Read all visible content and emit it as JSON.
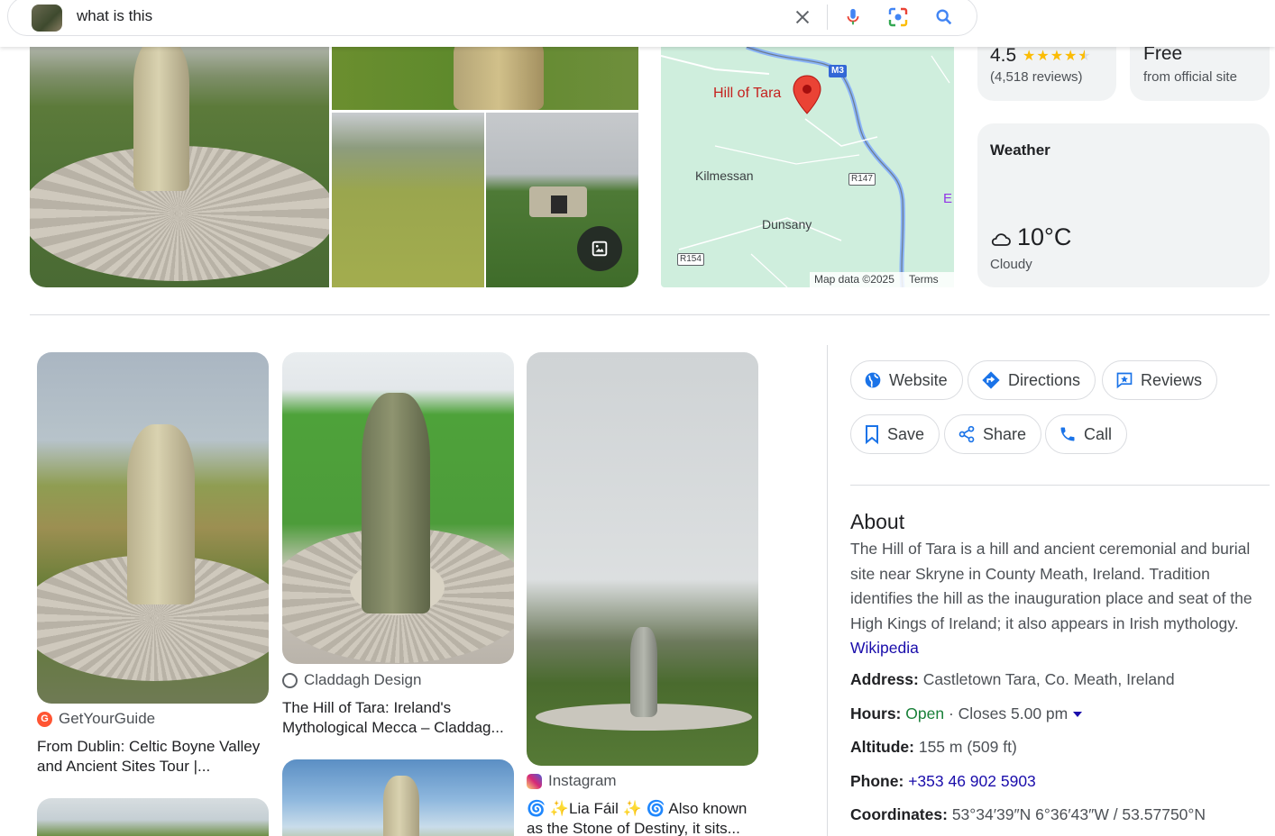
{
  "search": {
    "query": "what is this"
  },
  "map": {
    "place_label": "Hill of Tara",
    "towns": [
      "Kilmessan",
      "Dunsany"
    ],
    "roads": [
      "M3",
      "R147",
      "R154"
    ],
    "edge_letter": "E",
    "attribution": "Map data ©2025",
    "terms": "Terms"
  },
  "rating_card": {
    "rating": "4.5",
    "stars": 4.5,
    "reviews": "(4,518 reviews)"
  },
  "price_card": {
    "price": "Free",
    "note": "from official site"
  },
  "weather": {
    "title": "Weather",
    "temperature": "10°C",
    "condition": "Cloudy",
    "icon": "cloud-icon"
  },
  "visual_matches": [
    {
      "source": "GetYourGuide",
      "title_line1": "From Dublin: Celtic Boyne Valley",
      "title_line2": "and Ancient Sites Tour |...",
      "source_color": "#ff5533"
    },
    {
      "source": "Claddagh Design",
      "title_line1": "The Hill of Tara: Ireland's",
      "title_line2": "Mythological Mecca – Claddag...",
      "source_color": "#5f6368"
    },
    {
      "source": "Instagram",
      "title_line1": "🌀 ✨Lia Fáil ✨ 🌀 Also known",
      "title_line2": "as the Stone of Destiny, it sits...",
      "source_color": "#e1306c"
    }
  ],
  "actions": {
    "website": "Website",
    "directions": "Directions",
    "reviews": "Reviews",
    "save": "Save",
    "share": "Share",
    "call": "Call"
  },
  "about": {
    "heading": "About",
    "text": "The Hill of Tara is a hill and ancient ceremonial and burial site near Skryne in County Meath, Ireland. Tradition identifies the hill as the inauguration place and seat of the High Kings of Ireland; it also appears in Irish mythology.",
    "source_link": "Wikipedia"
  },
  "facts": {
    "address_label": "Address:",
    "address": "Castletown Tara, Co. Meath, Ireland",
    "hours_label": "Hours:",
    "hours_status": "Open",
    "hours_detail": "· Closes 5.00 pm",
    "altitude_label": "Altitude:",
    "altitude": "155 m (509 ft)",
    "phone_label": "Phone:",
    "phone": "+353 46 902 5903",
    "coordinates_label": "Coordinates:",
    "coordinates": "53°34′39″N 6°36′43″W / 53.57750°N"
  },
  "colors": {
    "link": "#1a0dab",
    "open": "#188038",
    "accent_blue": "#1a73e8",
    "pin_red": "#ea4335"
  }
}
